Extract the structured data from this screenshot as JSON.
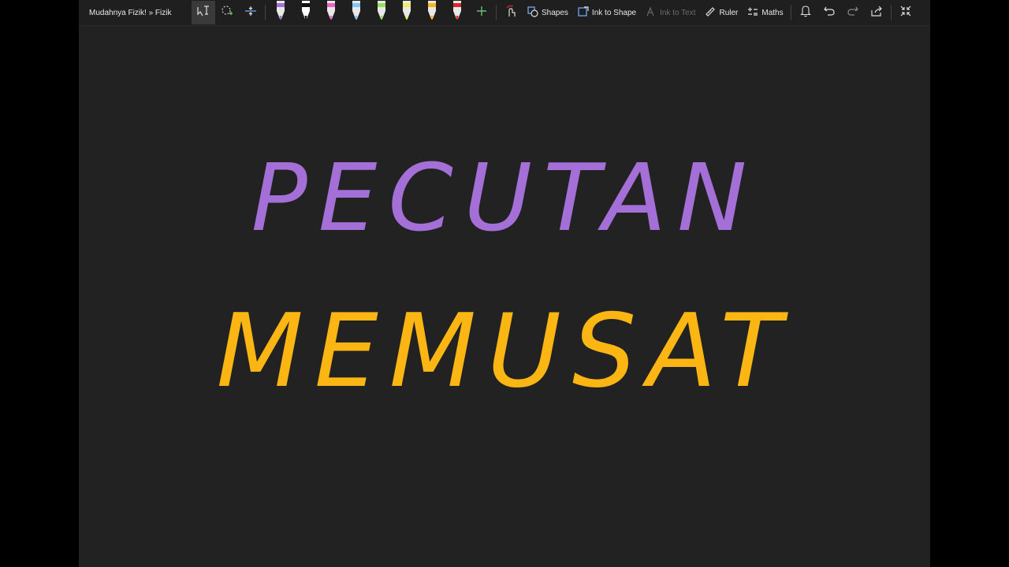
{
  "toolbar": {
    "breadcrumb": "Mudahnya Fizik! » Fizik",
    "pens": [
      {
        "name": "purple",
        "color": "#a46fd6"
      },
      {
        "name": "black",
        "color": "#111111"
      },
      {
        "name": "pink",
        "color": "#f062c8"
      },
      {
        "name": "light-blue",
        "color": "#78c8ff"
      },
      {
        "name": "green",
        "color": "#98e05a"
      },
      {
        "name": "yellow",
        "color": "#f5ea5a"
      },
      {
        "name": "gold",
        "color": "#fbb613"
      },
      {
        "name": "red",
        "color": "#e0242c"
      }
    ],
    "shapes_label": "Shapes",
    "ink_to_shape_label": "Ink to Shape",
    "ink_to_text_label": "Ink to Text",
    "ruler_label": "Ruler",
    "maths_label": "Maths"
  },
  "canvas": {
    "line1": {
      "text": "PECUTAN",
      "color": "#a46fd6"
    },
    "line2": {
      "text": "MEMUSAT",
      "color": "#fbb613"
    }
  }
}
